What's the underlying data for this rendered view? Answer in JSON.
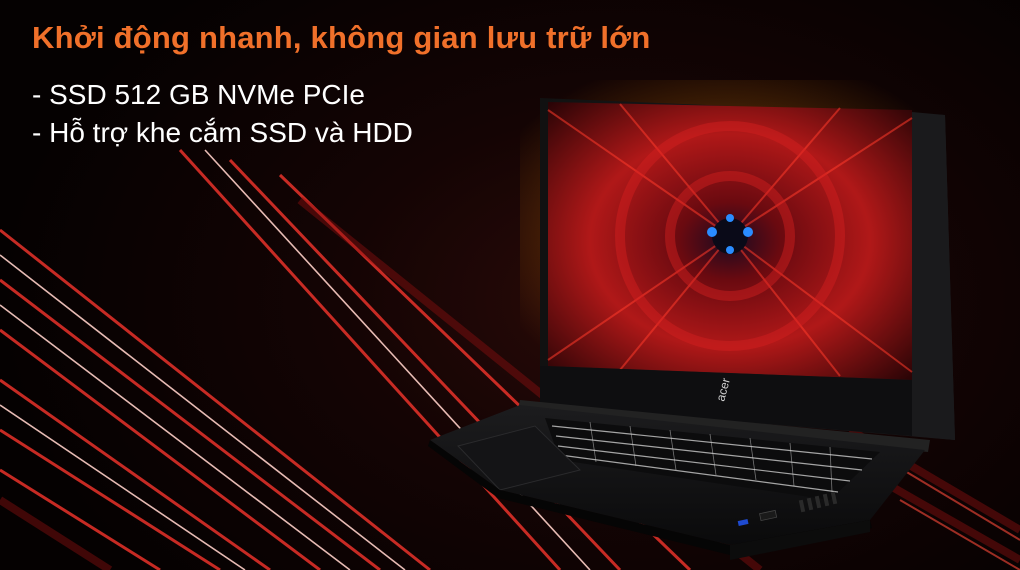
{
  "headline": "Khởi động nhanh, không gian lưu trữ lớn",
  "bullets": [
    "- SSD 512 GB NVMe PCIe",
    "- Hỗ trợ khe cắm SSD và HDD"
  ],
  "laptop": {
    "brand_logo": "acer"
  },
  "colors": {
    "headline": "#f0702a",
    "text": "#ffffff",
    "accent_red": "#e0281e",
    "background": "#0a0202"
  }
}
